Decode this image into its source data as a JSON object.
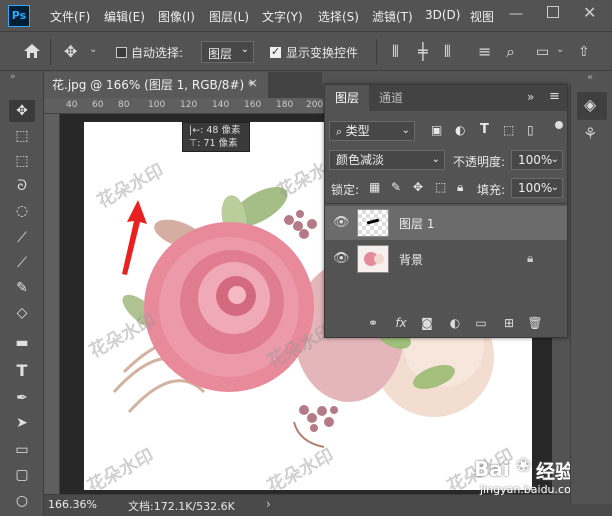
{
  "app": {
    "logo": "Ps"
  },
  "menu": [
    "文件(F)",
    "编辑(E)",
    "图像(I)",
    "图层(L)",
    "文字(Y)",
    "选择(S)",
    "滤镜(T)",
    "3D(D)",
    "视图"
  ],
  "options": {
    "auto_select_label": "自动选择:",
    "layer_dropdown": "图层",
    "show_transform_label": "显示变换控件"
  },
  "document": {
    "tab_title": "花.jpg @ 166% (图层 1, RGB/8#) *",
    "close": "×"
  },
  "ruler": {
    "ticks": [
      "40",
      "60",
      "80",
      "100",
      "120",
      "140",
      "160",
      "180",
      "200",
      "220"
    ]
  },
  "tooltip": {
    "line1": "|←: 48 像素",
    "line2": "⊤: 71 像素"
  },
  "watermark": {
    "text": "花朵水印"
  },
  "status": {
    "zoom": "166.36%",
    "doc_info": "文档:172.1K/532.6K",
    "arrow": "›"
  },
  "layers_panel": {
    "tab_layers": "图层",
    "tab_channels": "通道",
    "kind_filter": "类型",
    "blend_mode": "颜色减淡",
    "opacity_label": "不透明度:",
    "opacity_value": "100%",
    "lock_label": "锁定:",
    "fill_label": "填充:",
    "fill_value": "100%",
    "layers": [
      {
        "name": "图层 1",
        "visible": true,
        "selected": true
      },
      {
        "name": "背景",
        "visible": true,
        "selected": false,
        "locked": true
      }
    ]
  },
  "baidu": {
    "brand": "Bai",
    "brand2": "经验",
    "url": "jingyan.baidu.com"
  }
}
